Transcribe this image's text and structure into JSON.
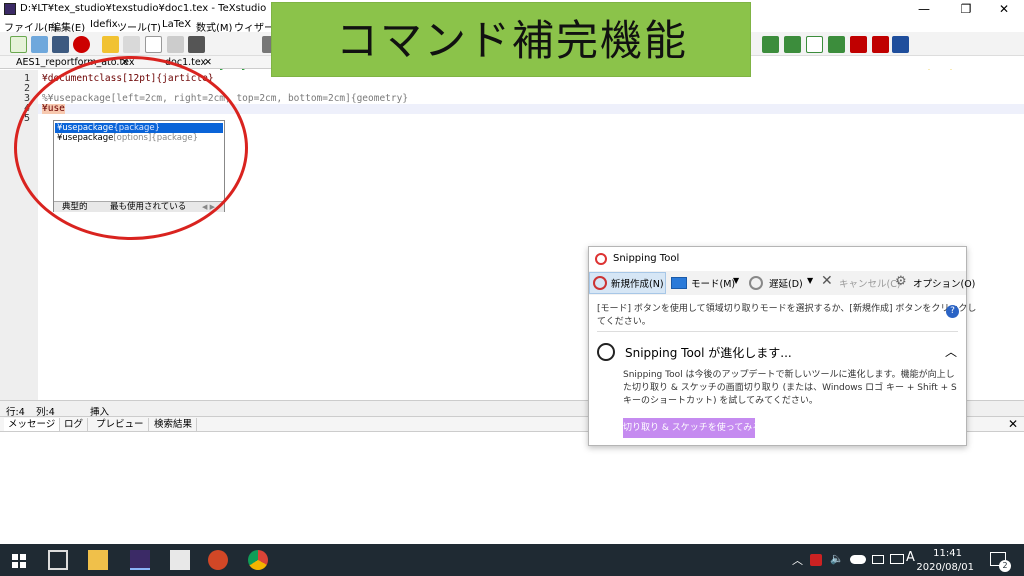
{
  "window": {
    "title": "D:¥LT¥tex_studio¥texstudio¥doc1.tex - TeXstudio",
    "minimize_glyph": "—",
    "restore_glyph": "❐",
    "close_glyph": "✕"
  },
  "menu": [
    "ファイル(F)",
    "編集(E)",
    "Idefix",
    "ツール(T)",
    "LaTeX",
    "数式(M)",
    "ウィザード"
  ],
  "banner": {
    "text": "コマンド補完機能",
    "color": "#8bc34a"
  },
  "tabs": [
    {
      "label": "AES1_reportform_ato.tex",
      "close": "✕"
    },
    {
      "label": "doc1.tex",
      "close": "✕"
    }
  ],
  "editor": {
    "line_numbers": [
      "1",
      "2",
      "3",
      "4",
      "5"
    ],
    "lines": [
      "¥documentclass[12pt]{jarticle}",
      "",
      "%¥usepackage[left=2cm, right=2cm, top=2cm, bottom=2cm]{geometry}",
      "¥use",
      ""
    ]
  },
  "autocomplete": {
    "items": [
      {
        "cmd": "¥usepackage",
        "arg": "{package}"
      },
      {
        "cmd": "¥usepackage",
        "arg": "[options]{package}"
      }
    ],
    "tabs": [
      "典型的",
      "最も使用されている"
    ],
    "arrows": "◀ ▶"
  },
  "status": {
    "row": "行:4",
    "col": "列:4",
    "mode": "挿入"
  },
  "bottom_tabs": [
    "メッセージ",
    "ログ",
    "プレビュー",
    "検索結果"
  ],
  "bottom_close": "✕",
  "snipping": {
    "title": "Snipping Tool",
    "buttons": {
      "new": "新規作成(N)",
      "mode": "モード(M)",
      "delay": "遅延(D)",
      "cancel": "キャンセル(C)",
      "options": "オプション(O)"
    },
    "help_line1": "[モード] ボタンを使用して領域切り取りモードを選択するか、[新規作成] ボタンをクリックし",
    "help_line2": "てください。",
    "evolve_title": "Snipping Tool が進化します...",
    "evolve_line1": "Snipping Tool は今後のアップデートで新しいツールに進化します。機能が向上し",
    "evolve_line2": "た切り取り & スケッチの画面切り取り (または、Windows ロゴ キー + Shift + S",
    "evolve_line3": "キーのショートカット) を試してみてください。",
    "evolve_button": "切り取り & スケッチを使ってみる",
    "help_glyph": "?",
    "collapse_glyph": "︿"
  },
  "taskbar": {
    "time": "11:41",
    "date": "2020/08/01",
    "notif_count": "2",
    "ime": "A"
  },
  "colors": {
    "accent_red": "#d9231f",
    "selection": "#0a64d8",
    "taskbar": "#1f2a33",
    "snip_button": "#c58bf0"
  }
}
